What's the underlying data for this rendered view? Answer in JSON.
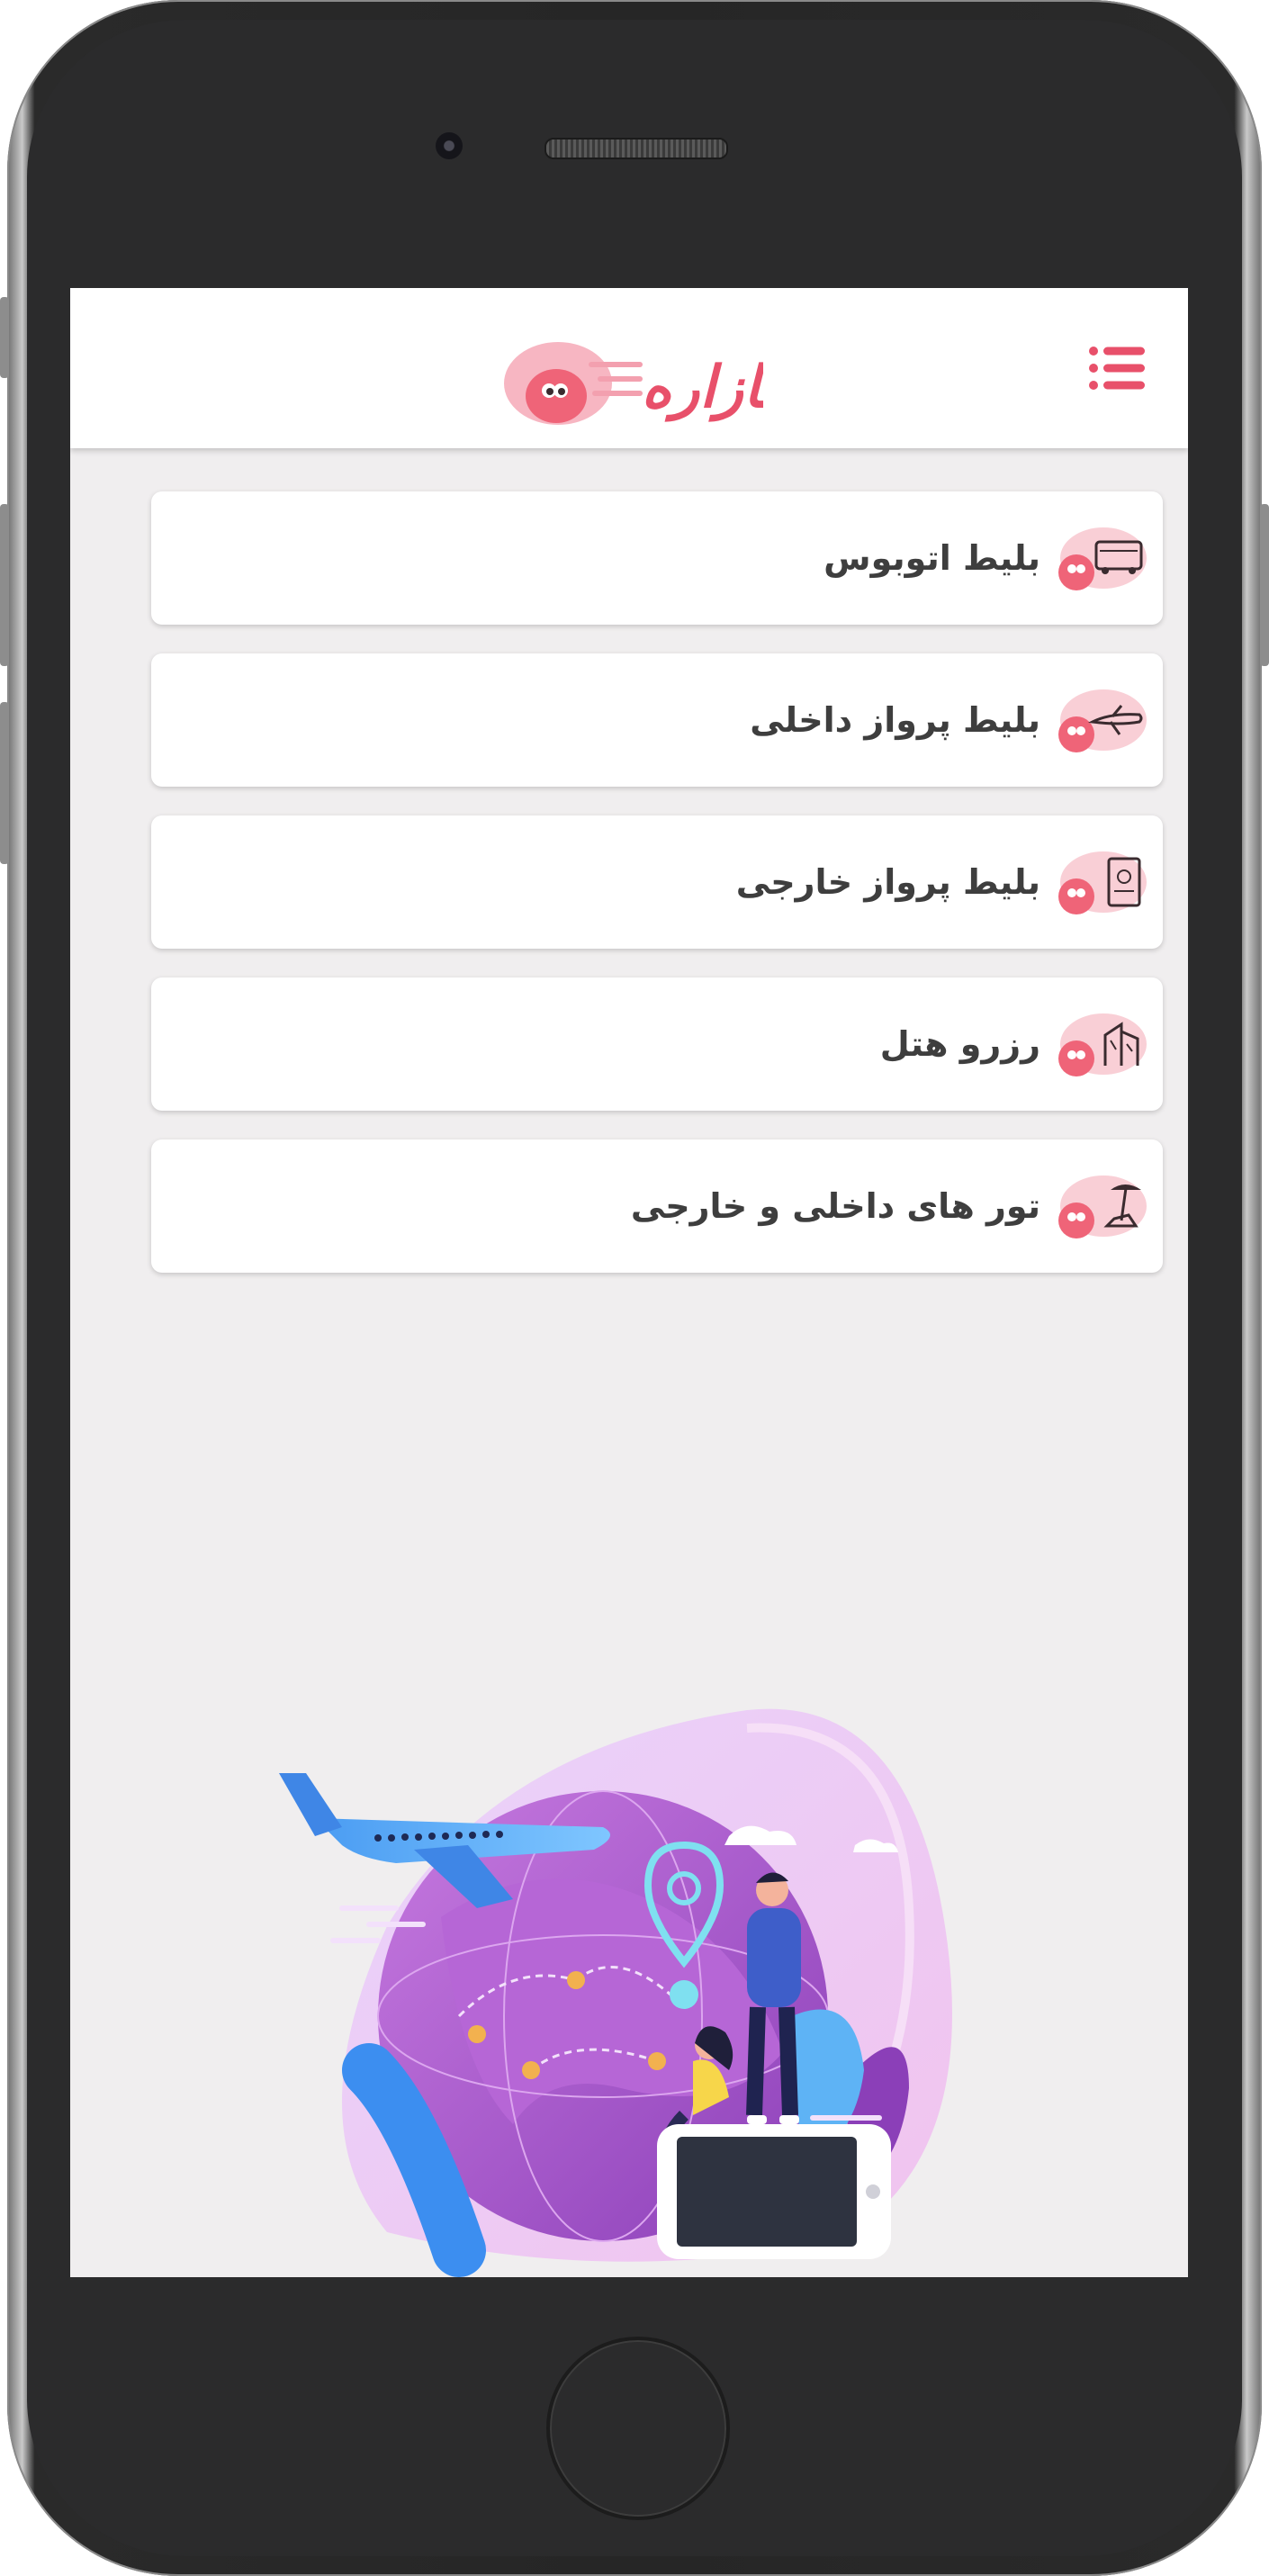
{
  "header": {
    "logo_text": "بازاره",
    "menu_icon": "list-menu-icon"
  },
  "menu_items": [
    {
      "label": "بلیط اتوبوس",
      "icon": "bus-icon"
    },
    {
      "label": "بلیط پرواز داخلی",
      "icon": "airplane-icon"
    },
    {
      "label": "بلیط پرواز خارجی",
      "icon": "passport-icon"
    },
    {
      "label": "رزرو هتل",
      "icon": "hotel-icon"
    },
    {
      "label": "تور های داخلی و خارجی",
      "icon": "beach-umbrella-icon"
    }
  ],
  "colors": {
    "accent": "#e8506a",
    "accent_light": "#f7b6c2",
    "screen_bg": "#f0eeef",
    "label_text": "#3e3e3e"
  },
  "illustration": "travel-globe-illustration"
}
